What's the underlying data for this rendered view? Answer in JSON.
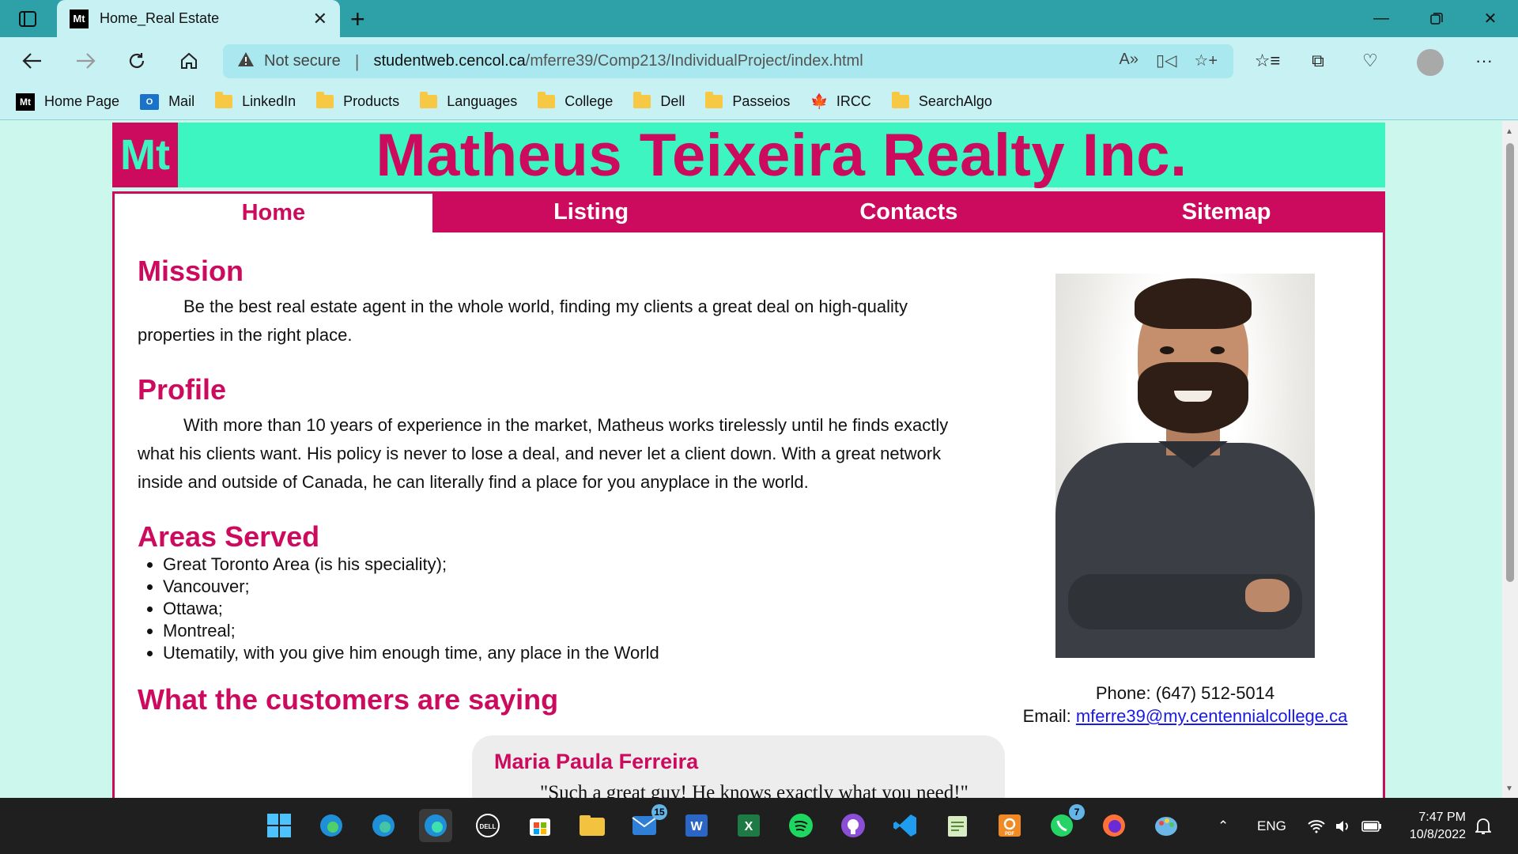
{
  "browser": {
    "tab_title": "Home_Real Estate",
    "tab_favicon": "Mt",
    "address": {
      "security_label": "Not secure",
      "url_host": "studentweb.cencol.ca",
      "url_path": "/mferre39/Comp213/IndividualProject/index.html"
    },
    "bookmarks": [
      {
        "label": "Home Page",
        "icon": "mt-favicon-icon"
      },
      {
        "label": "Mail",
        "icon": "mail-icon"
      },
      {
        "label": "LinkedIn",
        "icon": "folder-icon"
      },
      {
        "label": "Products",
        "icon": "folder-icon"
      },
      {
        "label": "Languages",
        "icon": "folder-icon"
      },
      {
        "label": "College",
        "icon": "folder-icon"
      },
      {
        "label": "Dell",
        "icon": "folder-icon"
      },
      {
        "label": "Passeios",
        "icon": "folder-icon"
      },
      {
        "label": "IRCC",
        "icon": "maple-leaf-icon"
      },
      {
        "label": "SearchAlgo",
        "icon": "folder-icon"
      }
    ]
  },
  "site": {
    "logo": "Mt",
    "title": "Matheus Teixeira Realty Inc.",
    "menu": [
      {
        "label": "Home",
        "active": true
      },
      {
        "label": "Listing",
        "active": false
      },
      {
        "label": "Contacts",
        "active": false
      },
      {
        "label": "Sitemap",
        "active": false
      }
    ],
    "mission": {
      "heading": "Mission",
      "text": "Be the best real estate agent in the whole world, finding my clients a great deal on high-quality properties in the right place."
    },
    "profile": {
      "heading": "Profile",
      "text": "With more than 10 years of experience in the market, Matheus works tirelessly until he finds exactly what his clients want. His policy is never to lose a deal, and never let a client down. With a great network inside and outside of Canada, he can literally find a place for you anyplace in the world."
    },
    "areas": {
      "heading": "Areas Served",
      "items": [
        "Great Toronto Area (is his speciality);",
        "Vancouver;",
        "Ottawa;",
        "Montreal;",
        "Utematily, with you give him enough time, any place in the World"
      ]
    },
    "testimonials": {
      "heading": "What the customers are saying",
      "first": {
        "name": "Maria Paula Ferreira",
        "quote": "\"Such a great guy! He knows exactly what you need!\""
      }
    },
    "contact": {
      "phone_label": "Phone: ",
      "phone": "(647) 512-5014",
      "email_label": "Email: ",
      "email": "mferre39@my.centennialcollege.ca"
    }
  },
  "taskbar": {
    "language": "ENG",
    "time": "7:47 PM",
    "date": "10/8/2022",
    "mail_badge": "15",
    "whatsapp_badge": "7"
  },
  "colors": {
    "brand_magenta": "#cc0a5e",
    "brand_mint": "#3df5c0",
    "page_background": "#ccf7ec",
    "browser_teal": "#2ea0a8"
  }
}
